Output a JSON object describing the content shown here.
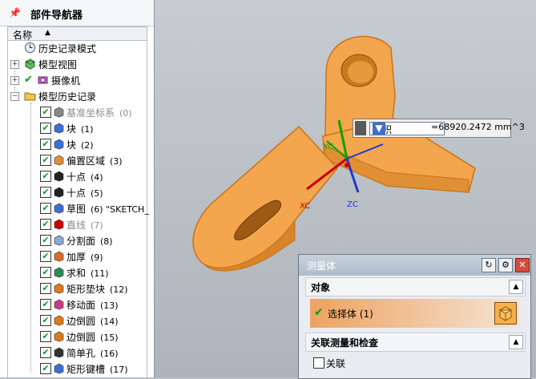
{
  "navigator": {
    "title": "部件导航器",
    "column_header": "名称",
    "nodes": [
      {
        "label": "历史记录模式",
        "icon": "clock-icon",
        "muted": false
      },
      {
        "label": "模型视图",
        "icon": "model-views-icon",
        "muted": false
      },
      {
        "label": "摄像机",
        "icon": "camera-icon",
        "muted": false
      },
      {
        "label": "模型历史记录",
        "icon": "folder-icon",
        "muted": false
      }
    ],
    "features": [
      {
        "label": "基准坐标系",
        "index": "(0)",
        "icon": "datum-csys-icon",
        "muted": true
      },
      {
        "label": "块",
        "index": "(1)",
        "icon": "block-icon",
        "muted": false
      },
      {
        "label": "块",
        "index": "(2)",
        "icon": "block-icon",
        "muted": false
      },
      {
        "label": "偏置区域",
        "index": "(3)",
        "icon": "offset-region-icon",
        "muted": false
      },
      {
        "label": "十点",
        "index": "(4)",
        "icon": "point-icon",
        "muted": false
      },
      {
        "label": "十点",
        "index": "(5)",
        "icon": "point-icon",
        "muted": false
      },
      {
        "label": "草图",
        "index": "(6) \"SKETCH_",
        "icon": "sketch-icon",
        "muted": false
      },
      {
        "label": "直线",
        "index": "(7)",
        "icon": "line-icon",
        "muted": true
      },
      {
        "label": "分割面",
        "index": "(8)",
        "icon": "divide-face-icon",
        "muted": false
      },
      {
        "label": "加厚",
        "index": "(9)",
        "icon": "thicken-icon",
        "muted": false
      },
      {
        "label": "求和",
        "index": "(11)",
        "icon": "unite-icon",
        "muted": false
      },
      {
        "label": "矩形垫块",
        "index": "(12)",
        "icon": "pad-icon",
        "muted": false
      },
      {
        "label": "移动面",
        "index": "(13)",
        "icon": "move-face-icon",
        "muted": false
      },
      {
        "label": "边倒圆",
        "index": "(14)",
        "icon": "edge-blend-icon",
        "muted": false
      },
      {
        "label": "边倒圆",
        "index": "(15)",
        "icon": "edge-blend-icon",
        "muted": false
      },
      {
        "label": "简单孔",
        "index": "(16)",
        "icon": "hole-icon",
        "muted": false
      },
      {
        "label": "矩形键槽",
        "index": "(17)",
        "icon": "slot-icon",
        "muted": false
      }
    ]
  },
  "viewport": {
    "axis_labels": {
      "x": "XC",
      "y": "YC",
      "z": "ZC"
    },
    "measure": {
      "selected": "体积",
      "value": "=68920.2472 mm^3"
    }
  },
  "dialog": {
    "title": "测量体",
    "section_objects": "对象",
    "select_body_label": "选择体 (1)",
    "section_related": "关联测量和检查",
    "associative_label": "关联"
  },
  "colors": {
    "part": "#f3a64d",
    "part_edge": "#c87416",
    "accent": "#3c6fd0"
  }
}
